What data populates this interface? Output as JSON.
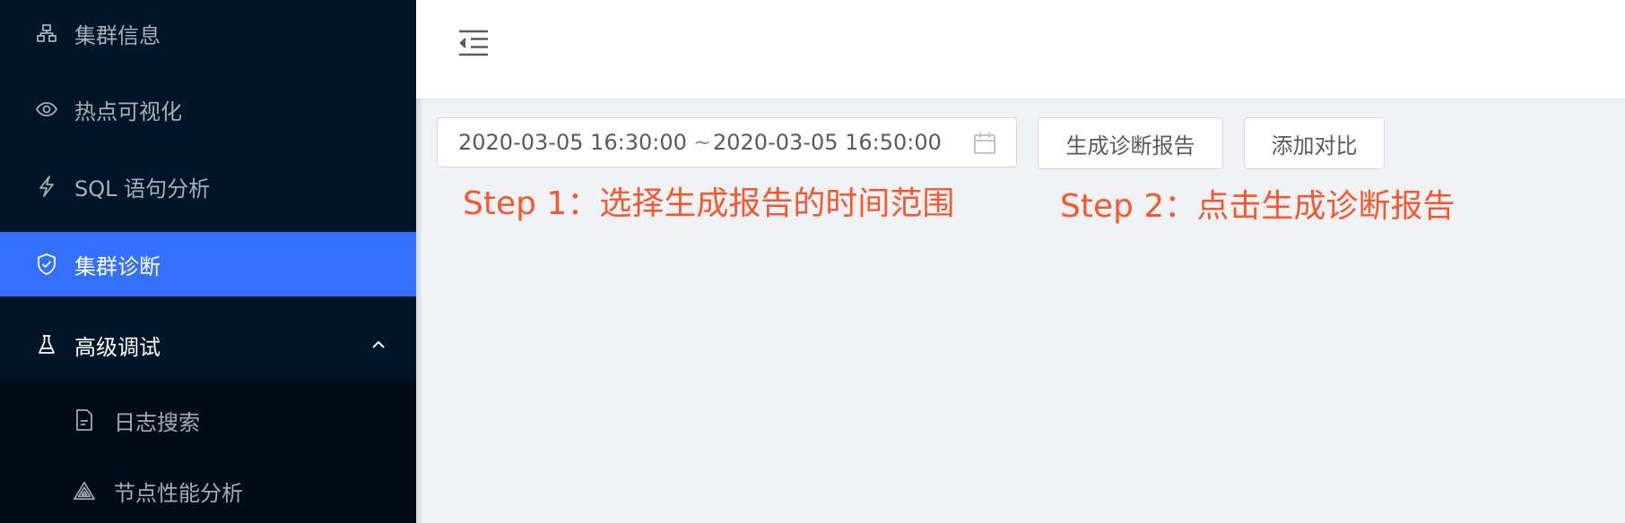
{
  "sidebar": {
    "items": [
      {
        "label": "集群信息",
        "icon": "cluster-icon"
      },
      {
        "label": "热点可视化",
        "icon": "eye-icon"
      },
      {
        "label": "SQL 语句分析",
        "icon": "lightning-icon"
      },
      {
        "label": "集群诊断",
        "icon": "shield-check-icon",
        "active": true
      },
      {
        "label": "高级调试",
        "icon": "flask-icon",
        "expanded": true
      }
    ],
    "submenu": [
      {
        "label": "日志搜索",
        "icon": "file-text-icon"
      },
      {
        "label": "节点性能分析",
        "icon": "triangle-icon"
      }
    ]
  },
  "header": {
    "fold_icon": "menu-fold-icon"
  },
  "range_picker": {
    "start": "2020-03-05 16:30:00",
    "separator": "~",
    "end": "2020-03-05 16:50:00",
    "icon": "calendar-icon"
  },
  "buttons": {
    "generate": "生成诊断报告",
    "compare": "添加对比"
  },
  "annotations": {
    "step1": "Step 1：选择生成报告的时间范围",
    "step2": "Step 2：点击生成诊断报告"
  },
  "colors": {
    "sidebar_bg": "#001529",
    "submenu_bg": "#000c17",
    "active": "#3370ff",
    "annotation": "#f5582f",
    "content_bg": "#f0f2f5"
  }
}
